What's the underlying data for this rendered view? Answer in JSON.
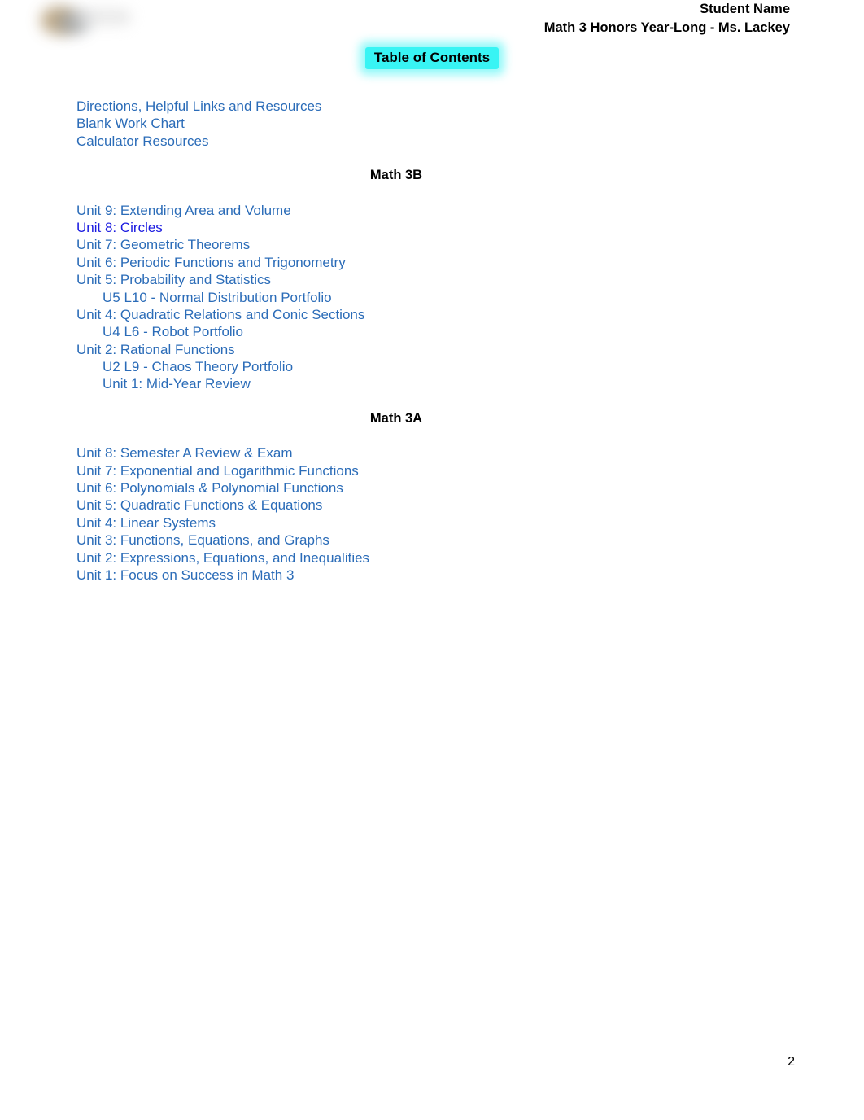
{
  "header": {
    "student_name": "Student Name",
    "course_line": "Math 3 Honors Year-Long - Ms. Lackey",
    "logo": "blurred-school-logo"
  },
  "title": "Table of Contents",
  "toc": {
    "top_links": [
      {
        "label": "Directions, Helpful Links and Resources",
        "indent": 0,
        "visited": false
      },
      {
        "label": "Blank Work Chart",
        "indent": 0,
        "visited": false
      },
      {
        "label": "Calculator Resources",
        "indent": 0,
        "visited": false
      }
    ],
    "sections": [
      {
        "heading": "Math 3B",
        "items": [
          {
            "label": "Unit 9:  Extending Area and Volume",
            "indent": 0,
            "visited": false
          },
          {
            "label": "Unit 8: Circles",
            "indent": 0,
            "visited": true
          },
          {
            "label": "Unit 7:  Geometric Theorems",
            "indent": 0,
            "visited": false
          },
          {
            "label": "Unit 6: Periodic Functions and Trigonometry",
            "indent": 0,
            "visited": false
          },
          {
            "label": "Unit 5: Probability and Statistics",
            "indent": 0,
            "visited": false
          },
          {
            "label": "U5 L10 - Normal Distribution Portfolio",
            "indent": 1,
            "visited": false
          },
          {
            "label": "Unit 4: Quadratic Relations and Conic Sections",
            "indent": 0,
            "visited": false
          },
          {
            "label": "U4 L6 - Robot Portfolio",
            "indent": 1,
            "visited": false
          },
          {
            "label": "Unit 2: Rational Functions",
            "indent": 0,
            "visited": false
          },
          {
            "label": "U2 L9 - Chaos Theory Portfolio",
            "indent": 1,
            "visited": false
          },
          {
            "label": "Unit 1: Mid-Year Review",
            "indent": 1,
            "visited": false
          }
        ]
      },
      {
        "heading": "Math 3A",
        "items": [
          {
            "label": "Unit 8: Semester A Review & Exam",
            "indent": 0,
            "visited": false
          },
          {
            "label": "Unit 7: Exponential and Logarithmic Functions",
            "indent": 0,
            "visited": false
          },
          {
            "label": "Unit 6: Polynomials & Polynomial Functions",
            "indent": 0,
            "visited": false
          },
          {
            "label": "Unit 5: Quadratic Functions & Equations",
            "indent": 0,
            "visited": false
          },
          {
            "label": "Unit 4: Linear Systems",
            "indent": 0,
            "visited": false
          },
          {
            "label": "Unit 3: Functions, Equations, and Graphs",
            "indent": 0,
            "visited": false
          },
          {
            "label": "Unit 2: Expressions, Equations, and Inequalities",
            "indent": 0,
            "visited": false
          },
          {
            "label": "Unit 1: Focus on Success in Math 3",
            "indent": 0,
            "visited": false
          }
        ]
      }
    ]
  },
  "footer": {
    "page_number": "2"
  },
  "colors": {
    "link": "#2b6cb8",
    "link_visited": "#1a1ae0",
    "highlight": "#38f4f4",
    "text": "#000000"
  }
}
